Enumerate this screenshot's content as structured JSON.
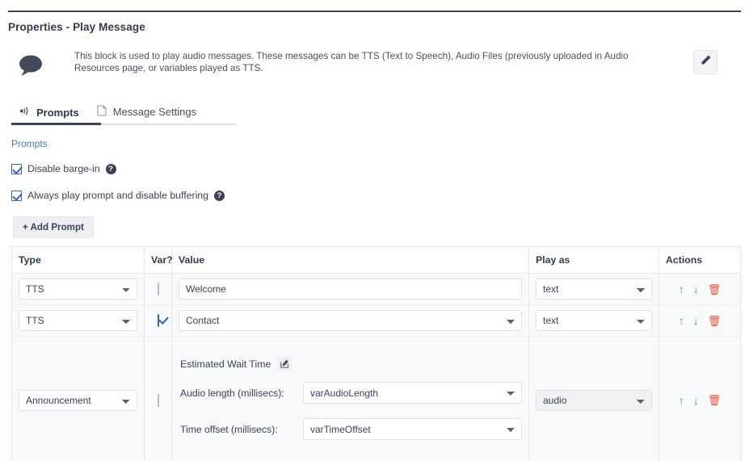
{
  "window": {
    "title": "Properties - Play Message"
  },
  "description": {
    "icon": "speech-bubble-icon",
    "text": "This block is used to play audio messages. These messages can be TTS (Text to Speech), Audio Files (previously uploaded in Audio Resources page, or variables played as TTS.",
    "edit_icon": "pencil-icon"
  },
  "tabs": [
    {
      "label": "Prompts",
      "icon": "audio-wave-icon",
      "active": true
    },
    {
      "label": "Message Settings",
      "icon": "document-icon",
      "active": false
    }
  ],
  "prompts_section": {
    "label": "Prompts",
    "options": [
      {
        "label": "Disable barge-in",
        "checked": true,
        "help": "?"
      },
      {
        "label": "Always play prompt and disable buffering",
        "checked": true,
        "help": "?"
      }
    ],
    "add_button": "+ Add Prompt"
  },
  "table": {
    "columns": [
      "Type",
      "Var?",
      "Value",
      "Play as",
      "Actions"
    ],
    "rows": [
      {
        "type": "TTS",
        "var_checked": false,
        "value_kind": "input",
        "value": "Welcome",
        "play_as": "text",
        "actions": {
          "up": "↑",
          "down": "↓",
          "delete": "🗑"
        }
      },
      {
        "type": "TTS",
        "var_checked": true,
        "value_kind": "select",
        "value": "Contact",
        "play_as": "text",
        "actions": {
          "up": "↑",
          "down": "↓",
          "delete": "🗑"
        }
      },
      {
        "type": "Announcement",
        "var_checked": false,
        "value_kind": "announcement",
        "announcement": {
          "title": "Estimated Wait Time",
          "edit_icon": "edit-square-icon",
          "fields": [
            {
              "label": "Audio length (millisecs):",
              "value": "varAudioLength"
            },
            {
              "label": "Time offset (millisecs):",
              "value": "varTimeOffset"
            }
          ]
        },
        "play_as": "audio",
        "actions": {
          "up": "↑",
          "down": "↓",
          "delete": "🗑"
        }
      }
    ]
  },
  "colors": {
    "accent_link": "#4a79c7",
    "checkbox": "#2f62c4",
    "action_move": "#4caf50",
    "action_delete": "#f4513b",
    "text": "#3c4257"
  }
}
